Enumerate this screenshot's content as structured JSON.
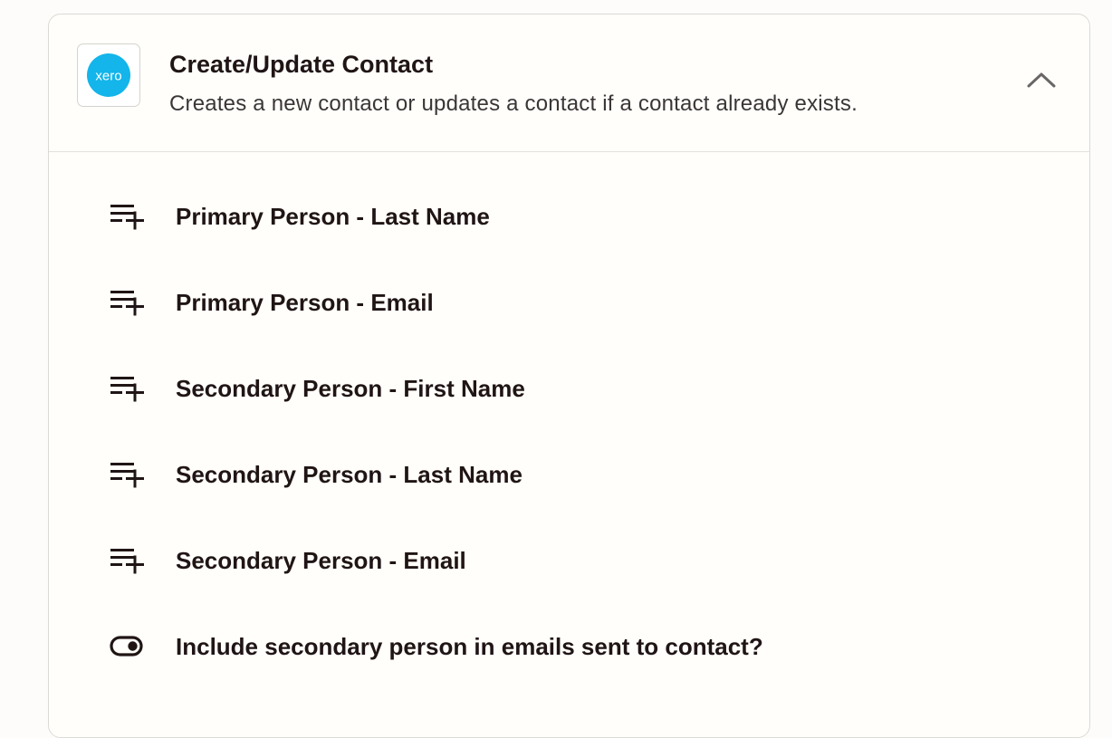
{
  "step": {
    "app_logo_text": "xero",
    "title": "Create/Update Contact",
    "description": "Creates a new contact or updates a contact if a contact already exists."
  },
  "fields": [
    {
      "label": "Primary Person - Last Name",
      "icon": "text-list-add-icon"
    },
    {
      "label": "Primary Person - Email",
      "icon": "text-list-add-icon"
    },
    {
      "label": "Secondary Person - First Name",
      "icon": "text-list-add-icon"
    },
    {
      "label": "Secondary Person - Last Name",
      "icon": "text-list-add-icon"
    },
    {
      "label": "Secondary Person - Email",
      "icon": "text-list-add-icon"
    },
    {
      "label": "Include secondary person in emails sent to contact?",
      "icon": "toggle-icon"
    }
  ],
  "colors": {
    "xero_brand": "#13b5ea",
    "text": "#201515",
    "border": "#dcdad6"
  }
}
